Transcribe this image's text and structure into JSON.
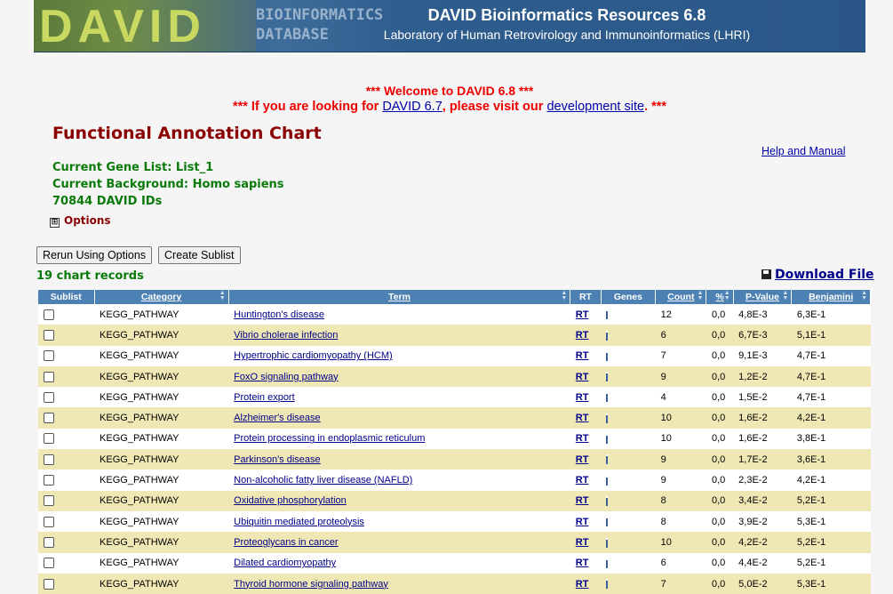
{
  "banner": {
    "logo": "DAVID",
    "logo_sub_1": "BIOINFORMATICS",
    "logo_sub_2": "DATABASE",
    "title": "DAVID Bioinformatics Resources 6.8",
    "subtitle": "Laboratory of Human Retrovirology and Immunoinformatics (LHRI)"
  },
  "welcome": {
    "line1": "*** Welcome to DAVID 6.8 ***",
    "line2_pre": "*** If you are looking for ",
    "link1": "DAVID 6.7",
    "line2_mid": ", please visit our ",
    "link2": "development site",
    "line2_post": ". ***"
  },
  "page_title": "Functional Annotation Chart",
  "help_link": "Help and Manual",
  "gene_list": "Current Gene List: List_1",
  "background": "Current Background: Homo sapiens",
  "ids": "70844 DAVID IDs",
  "options_toggle": "⊞",
  "options_label": "Options",
  "buttons": {
    "rerun": "Rerun Using Options",
    "create": "Create Sublist"
  },
  "record_count": "19 chart records",
  "download_label": "Download File",
  "columns": [
    "Sublist",
    "Category",
    "Term",
    "RT",
    "Genes",
    "Count",
    "%",
    "P-Value",
    "Benjamini"
  ],
  "rows": [
    {
      "category": "KEGG_PATHWAY",
      "term": "Huntington's disease",
      "rt": "RT",
      "count": "12",
      "pct": "0,0",
      "pvalue": "4,8E-3",
      "benjamini": "6,3E-1"
    },
    {
      "category": "KEGG_PATHWAY",
      "term": "Vibrio cholerae infection",
      "rt": "RT",
      "count": "6",
      "pct": "0,0",
      "pvalue": "6,7E-3",
      "benjamini": "5,1E-1"
    },
    {
      "category": "KEGG_PATHWAY",
      "term": "Hypertrophic cardiomyopathy (HCM)",
      "rt": "RT",
      "count": "7",
      "pct": "0,0",
      "pvalue": "9,1E-3",
      "benjamini": "4,7E-1"
    },
    {
      "category": "KEGG_PATHWAY",
      "term": "FoxO signaling pathway",
      "rt": "RT",
      "count": "9",
      "pct": "0,0",
      "pvalue": "1,2E-2",
      "benjamini": "4,7E-1"
    },
    {
      "category": "KEGG_PATHWAY",
      "term": "Protein export",
      "rt": "RT",
      "count": "4",
      "pct": "0,0",
      "pvalue": "1,5E-2",
      "benjamini": "4,7E-1"
    },
    {
      "category": "KEGG_PATHWAY",
      "term": "Alzheimer's disease",
      "rt": "RT",
      "count": "10",
      "pct": "0,0",
      "pvalue": "1,6E-2",
      "benjamini": "4,2E-1"
    },
    {
      "category": "KEGG_PATHWAY",
      "term": "Protein processing in endoplasmic reticulum",
      "rt": "RT",
      "count": "10",
      "pct": "0,0",
      "pvalue": "1,6E-2",
      "benjamini": "3,8E-1"
    },
    {
      "category": "KEGG_PATHWAY",
      "term": "Parkinson's disease",
      "rt": "RT",
      "count": "9",
      "pct": "0,0",
      "pvalue": "1,7E-2",
      "benjamini": "3,6E-1"
    },
    {
      "category": "KEGG_PATHWAY",
      "term": "Non-alcoholic fatty liver disease (NAFLD)",
      "rt": "RT",
      "count": "9",
      "pct": "0,0",
      "pvalue": "2,3E-2",
      "benjamini": "4,2E-1"
    },
    {
      "category": "KEGG_PATHWAY",
      "term": "Oxidative phosphorylation",
      "rt": "RT",
      "count": "8",
      "pct": "0,0",
      "pvalue": "3,4E-2",
      "benjamini": "5,2E-1"
    },
    {
      "category": "KEGG_PATHWAY",
      "term": "Ubiquitin mediated proteolysis",
      "rt": "RT",
      "count": "8",
      "pct": "0,0",
      "pvalue": "3,9E-2",
      "benjamini": "5,3E-1"
    },
    {
      "category": "KEGG_PATHWAY",
      "term": "Proteoglycans in cancer",
      "rt": "RT",
      "count": "10",
      "pct": "0,0",
      "pvalue": "4,2E-2",
      "benjamini": "5,2E-1"
    },
    {
      "category": "KEGG_PATHWAY",
      "term": "Dilated cardiomyopathy",
      "rt": "RT",
      "count": "6",
      "pct": "0,0",
      "pvalue": "4,4E-2",
      "benjamini": "5,2E-1"
    },
    {
      "category": "KEGG_PATHWAY",
      "term": "Thyroid hormone signaling pathway",
      "rt": "RT",
      "count": "7",
      "pct": "0,0",
      "pvalue": "5,0E-2",
      "benjamini": "5,3E-1"
    }
  ]
}
